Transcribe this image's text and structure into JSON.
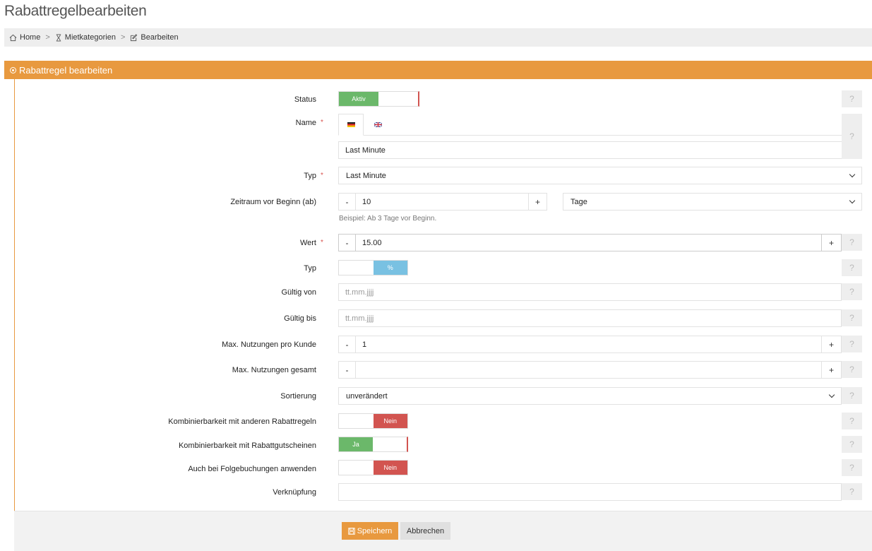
{
  "page": {
    "title": "Rabattregelbearbeiten"
  },
  "breadcrumb": {
    "items": [
      {
        "label": "Home",
        "icon": "home-icon"
      },
      {
        "label": "Mietkategorien",
        "icon": "hourglass-icon"
      },
      {
        "label": "Bearbeiten",
        "icon": "edit-icon"
      }
    ],
    "separator": ">"
  },
  "panel": {
    "title": "Rabattregel bearbeiten",
    "accent": "#e8993f"
  },
  "form": {
    "help_label": "?",
    "required_mark": "*",
    "status": {
      "label": "Status",
      "on_label": "Aktiv"
    },
    "name": {
      "label": "Name",
      "value": "Last Minute",
      "tabs": [
        "de-flag-icon",
        "gb-flag-icon"
      ]
    },
    "typ": {
      "label": "Typ",
      "value": "Last Minute"
    },
    "zeitraum": {
      "label": "Zeitraum vor Beginn (ab)",
      "minus": "-",
      "value": "10",
      "plus": "+",
      "unit": "Tage",
      "hint": "Beispiel: Ab 3 Tage vor Beginn."
    },
    "wert": {
      "label": "Wert",
      "minus": "-",
      "value": "15.00",
      "plus": "+"
    },
    "wert_typ": {
      "label": "Typ",
      "selected": "%"
    },
    "gueltig_von": {
      "label": "Gültig von",
      "placeholder": "tt.mm.jjjj"
    },
    "gueltig_bis": {
      "label": "Gültig bis",
      "placeholder": "tt.mm.jjjj"
    },
    "max_pro_kunde": {
      "label": "Max. Nutzungen pro Kunde",
      "minus": "-",
      "value": "1",
      "plus": "+"
    },
    "max_gesamt": {
      "label": "Max. Nutzungen gesamt",
      "minus": "-",
      "value": "",
      "plus": "+"
    },
    "sortierung": {
      "label": "Sortierung",
      "value": "unverändert"
    },
    "kombi_rabatt": {
      "label": "Kombinierbarkeit mit anderen Rabattregeln",
      "value": "Nein"
    },
    "kombi_gutschein": {
      "label": "Kombinierbarkeit mit Rabattgutscheinen",
      "value": "Ja"
    },
    "folgebuchungen": {
      "label": "Auch bei Folgebuchungen anwenden",
      "value": "Nein"
    },
    "verknuepfung": {
      "label": "Verknüpfung",
      "value": ""
    }
  },
  "actions": {
    "save_label": "Speichern",
    "cancel_label": "Abbrechen"
  },
  "colors": {
    "green": "#6bb86a",
    "red": "#d25450",
    "blue": "#79c1e2",
    "orange": "#e8993f"
  }
}
